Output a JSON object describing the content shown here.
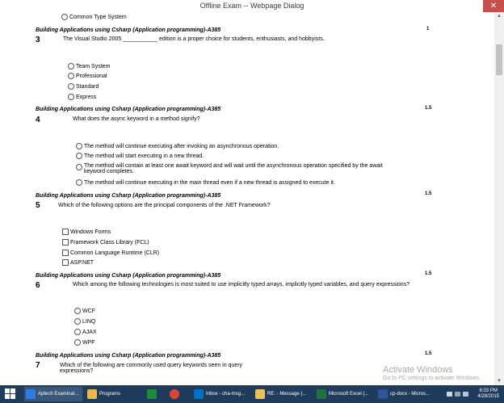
{
  "window": {
    "title": "Offline Exam -- Webpage Dialog"
  },
  "section_title": "Building Applications using Csharp (Application programming)-A385",
  "top_option": "Common Type System",
  "questions": [
    {
      "number": "3",
      "marks": "1",
      "text": "The Visual Studio 2005 ___________ edition is a proper choice for students, enthusiasts, and hobbyists.",
      "options": [
        "Team System",
        "Professional",
        "Standard",
        "Express"
      ]
    },
    {
      "number": "4",
      "marks": "1.5",
      "text": "What does the async keyword in a method signify?",
      "options": [
        "The method will continue executing after invoking an asynchronous operation.",
        "The method will start executing in a new thread.",
        "The method will contain at least one await keyword and will wait until the asynchronous operation specified by the await keyword completes.",
        "The method will continue executing in the main thread even if a new thread is assigned to execute it."
      ]
    },
    {
      "number": "5",
      "marks": "1.5",
      "text": "Which of the following options are the principal components of the .NET Framework?",
      "options": [
        "Windows Forms",
        "Framework Class Library (FCL)",
        "Common Language Runtime (CLR)",
        "ASP.NET"
      ]
    },
    {
      "number": "6",
      "marks": "1.5",
      "text": "Which among the following technologies is most suited to use implicitly typed arrays, implicitly typed variables, and query expressions?",
      "options": [
        "WCF",
        "LINQ",
        "AJAX",
        "WPF"
      ]
    },
    {
      "number": "7",
      "marks": "1.5",
      "text": "Which of the following are commonly used query keywords seen in query expressions?"
    }
  ],
  "watermark": {
    "line1": "Activate Windows",
    "line2": "Go to PC settings to activate Windows."
  },
  "taskbar": {
    "items": [
      {
        "label": "Aptech Examinat...",
        "icon_color": "#2b7de1"
      },
      {
        "label": "Programs",
        "icon_color": "#e8b84a"
      },
      {
        "label": "",
        "icon_color": "#1e8a3c"
      },
      {
        "label": "",
        "icon_color": "#db4437"
      },
      {
        "label": "Inbox - cha-msg...",
        "icon_color": "#0072c6"
      },
      {
        "label": "RE: - Message (...",
        "icon_color": "#e8c15a"
      },
      {
        "label": "Microsoft Excel (...",
        "icon_color": "#207245"
      },
      {
        "label": "cp-docx - Micros...",
        "icon_color": "#2b579a"
      }
    ],
    "time": "6:03 PM",
    "date": "4/28/2015"
  },
  "colors": {
    "taskbar": "#1f3c5c",
    "close_button": "#c7504c"
  }
}
